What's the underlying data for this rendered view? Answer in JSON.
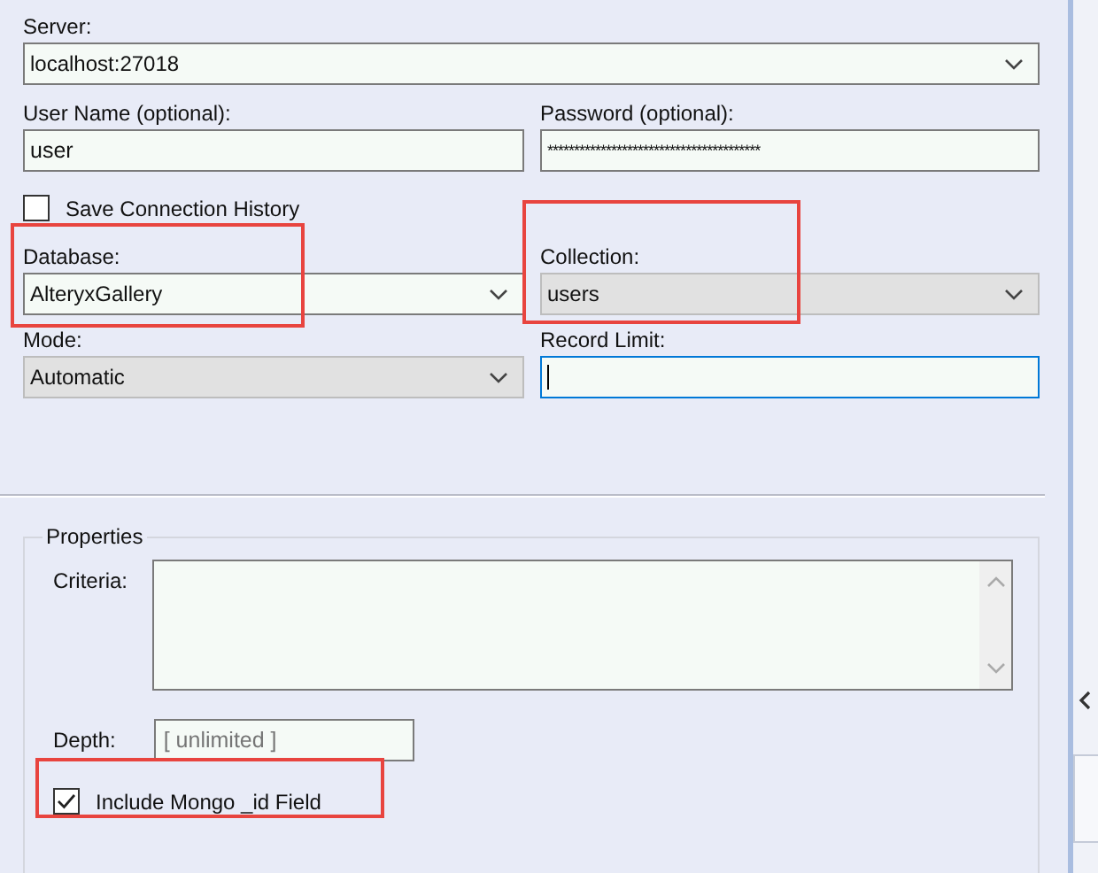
{
  "server": {
    "label": "Server:",
    "value": "localhost:27018",
    "disabled": false
  },
  "username": {
    "label": "User Name (optional):",
    "value": "user"
  },
  "password": {
    "label": "Password (optional):",
    "value": "****************************************"
  },
  "save_history": {
    "label": "Save Connection History",
    "checked": false
  },
  "database": {
    "label": "Database:",
    "value": "AlteryxGallery",
    "disabled": false,
    "highlighted": true
  },
  "collection": {
    "label": "Collection:",
    "value": "users",
    "disabled": true,
    "highlighted": true
  },
  "mode": {
    "label": "Mode:",
    "value": "Automatic",
    "disabled": true
  },
  "record_limit": {
    "label": "Record Limit:",
    "focused": true
  },
  "properties": {
    "title": "Properties",
    "criteria_label": "Criteria:",
    "depth_label": "Depth:",
    "depth_placeholder": "[ unlimited ]",
    "include_id": {
      "label": "Include Mongo _id Field",
      "checked": true,
      "highlighted": true
    }
  }
}
